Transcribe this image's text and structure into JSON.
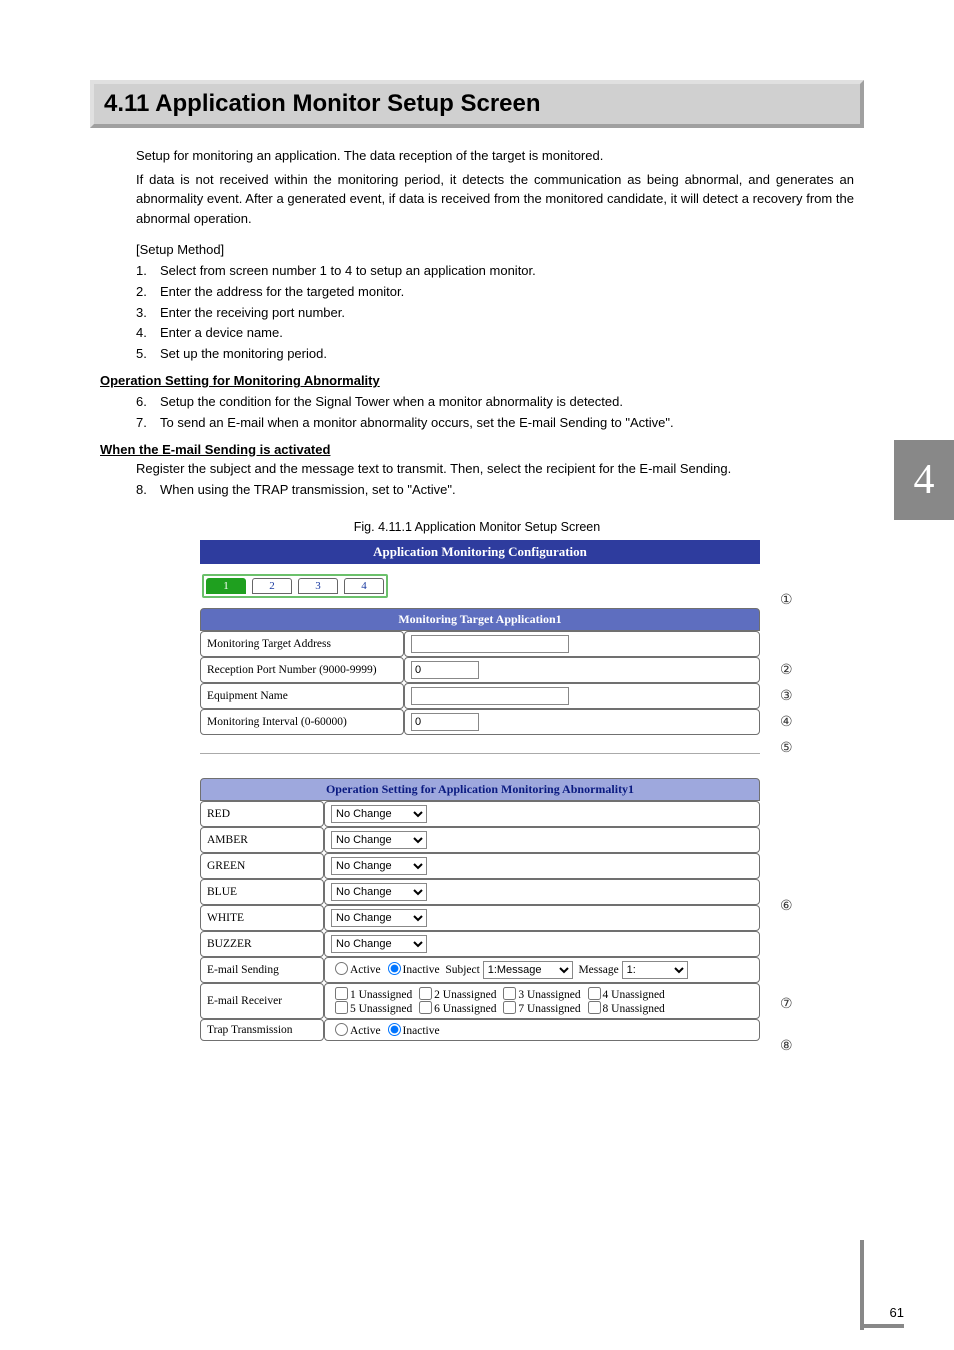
{
  "heading": "4.11 Application Monitor Setup Screen",
  "intro1": "Setup for monitoring an application.  The data reception of the target is monitored.",
  "intro2": "If data is not received within the monitoring period, it detects the communication as being abnormal, and generates an abnormality event.  After a generated event, if data is received from the monitored candidate, it will detect a recovery from the abnormal operation.",
  "setup_method_label": "[Setup Method]",
  "steps_a": [
    {
      "n": "1.",
      "t": "Select from screen number 1 to 4 to setup an application monitor."
    },
    {
      "n": "2.",
      "t": "Enter the address for the targeted monitor."
    },
    {
      "n": "3.",
      "t": "Enter the receiving port number."
    },
    {
      "n": "4.",
      "t": "Enter a device name."
    },
    {
      "n": "5.",
      "t": "Set up the monitoring period."
    }
  ],
  "sub1": "Operation Setting for Monitoring Abnormality",
  "steps_b": [
    {
      "n": "6.",
      "t": "Setup the condition for the Signal Tower when a monitor abnormality is detected."
    },
    {
      "n": "7.",
      "t": "To send an E-mail when a monitor abnormality occurs, set the E-mail Sending to \"Active\"."
    }
  ],
  "sub2": "When the E-mail Sending is activated",
  "register_line": "Register the subject and the message text to transmit.  Then, select the recipient for the E-mail Sending.",
  "steps_c": [
    {
      "n": "8.",
      "t": "When using the TRAP transmission, set to \"Active\"."
    }
  ],
  "fig_caption": "Fig. 4.11.1 Application Monitor Setup Screen",
  "shot": {
    "title": "Application Monitoring Configuration",
    "tabs": [
      "1",
      "2",
      "3",
      "4"
    ],
    "active_tab_index": 0,
    "panel1_header": "Monitoring Target Application1",
    "rows1": {
      "addr_label": "Monitoring Target Address",
      "addr_value": "",
      "port_label": "Reception Port Number (9000-9999)",
      "port_value": "0",
      "equip_label": "Equipment Name",
      "equip_value": "",
      "interval_label": "Monitoring Interval (0-60000)",
      "interval_value": "0"
    },
    "panel2_header": "Operation Setting for Application Monitoring Abnormality1",
    "towers": [
      {
        "label": "RED",
        "value": "No Change"
      },
      {
        "label": "AMBER",
        "value": "No Change"
      },
      {
        "label": "GREEN",
        "value": "No Change"
      },
      {
        "label": "BLUE",
        "value": "No Change"
      },
      {
        "label": "WHITE",
        "value": "No Change"
      },
      {
        "label": "BUZZER",
        "value": "No Change"
      }
    ],
    "email_row": {
      "label": "E-mail Sending",
      "active": "Active",
      "inactive": "Inactive",
      "subject_lbl": "Subject",
      "subject_value": "1:Message",
      "message_lbl": "Message",
      "message_value": "1:"
    },
    "receiver_row": {
      "label": "E-mail Receiver",
      "opts": [
        "1 Unassigned",
        "2 Unassigned",
        "3 Unassigned",
        "4 Unassigned",
        "5 Unassigned",
        "6 Unassigned",
        "7 Unassigned",
        "8 Unassigned"
      ]
    },
    "trap_row": {
      "label": "Trap Transmission",
      "active": "Active",
      "inactive": "Inactive"
    }
  },
  "callouts": {
    "c1": "①",
    "c2": "②",
    "c3": "③",
    "c4": "④",
    "c5": "⑤",
    "c6": "⑥",
    "c7": "⑦",
    "c8": "⑧"
  },
  "side_tab": "4",
  "page_number": "61"
}
